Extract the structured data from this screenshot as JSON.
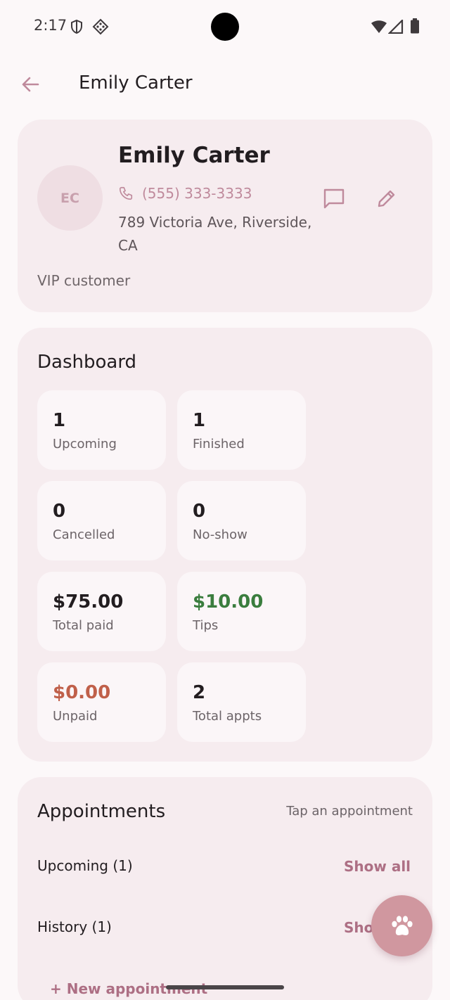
{
  "status_bar": {
    "time": "2:17",
    "icons": [
      "shield-icon",
      "pattern-icon",
      "wifi-icon",
      "signal-icon",
      "battery-icon"
    ]
  },
  "app_bar": {
    "back_icon": "arrow-left-icon",
    "title": "Emily Carter"
  },
  "profile": {
    "initials": "EC",
    "name": "Emily Carter",
    "phone": "(555) 333-3333",
    "address": "789 Victoria Ave, Riverside, CA",
    "note": "VIP customer",
    "actions": [
      "message-icon",
      "edit-icon"
    ]
  },
  "dashboard": {
    "title": "Dashboard",
    "stats": [
      {
        "value": "1",
        "label": "Upcoming"
      },
      {
        "value": "1",
        "label": "Finished"
      },
      {
        "value": "0",
        "label": "Cancelled"
      },
      {
        "value": "0",
        "label": "No-show"
      },
      {
        "value": "$75.00",
        "label": "Total paid"
      },
      {
        "value": "$10.00",
        "label": "Tips",
        "color": "#3a7d3e"
      },
      {
        "value": "$0.00",
        "label": "Unpaid",
        "color": "#c0604a"
      },
      {
        "value": "2",
        "label": "Total appts"
      }
    ]
  },
  "appointments": {
    "title": "Appointments",
    "hint": "Tap an appointment",
    "upcoming_label": "Upcoming (1)",
    "history_label": "History (1)",
    "show_all": "Show all",
    "show_all_history": "Sho",
    "new_appointment": "+ New appointment"
  },
  "fab": {
    "icon": "paw-icon"
  },
  "colors": {
    "accent": "#ad6f84",
    "fab": "#d0979f",
    "card": "#f6ecef",
    "tips": "#3a7d3e",
    "unpaid": "#c0604a"
  }
}
